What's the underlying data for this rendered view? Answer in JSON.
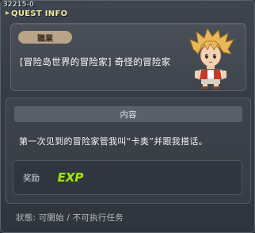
{
  "quest_id": "32215-0",
  "title": "QUEST INFO",
  "job_badge": "職業",
  "quest_name": "[冒险岛世界的冒险家] 奇怪的冒险家",
  "content_header": "内容",
  "description": "第一次见到的冒险家管我叫“卡奥”并跟我搭话。",
  "reward_label": "奖励",
  "reward_exp": "EXP",
  "status_label": "狀態:",
  "status_startable": "可開始",
  "status_separator": "/",
  "status_not_executable": "不可执行任务",
  "colors": {
    "title_text": "#f0eca0",
    "badge_bg": "#b9a48a",
    "exp_green": "#a6e020"
  },
  "icons": {
    "title_arrow": "arrow-right-icon",
    "reward": "exp-icon",
    "npc": "npc-avatar"
  }
}
